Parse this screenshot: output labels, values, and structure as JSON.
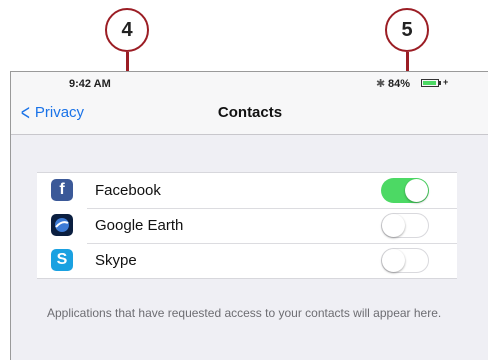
{
  "callouts": [
    "4",
    "5"
  ],
  "status_bar": {
    "time": "9:42 AM",
    "bluetooth_icon": "bluetooth-icon",
    "battery_percent": "84%",
    "battery_level": 0.84
  },
  "nav": {
    "back_label": "Privacy",
    "title": "Contacts"
  },
  "apps": [
    {
      "name": "Facebook",
      "icon": "facebook-icon",
      "icon_glyph": "f",
      "enabled": true
    },
    {
      "name": "Google Earth",
      "icon": "google-earth-icon",
      "icon_glyph": "",
      "enabled": false
    },
    {
      "name": "Skype",
      "icon": "skype-icon",
      "icon_glyph": "S",
      "enabled": false
    }
  ],
  "footer_text": "Applications that have requested access to your contacts will appear here.",
  "colors": {
    "accent": "#1a73e8",
    "toggle_on": "#4cd964",
    "callout": "#9b1d24"
  }
}
